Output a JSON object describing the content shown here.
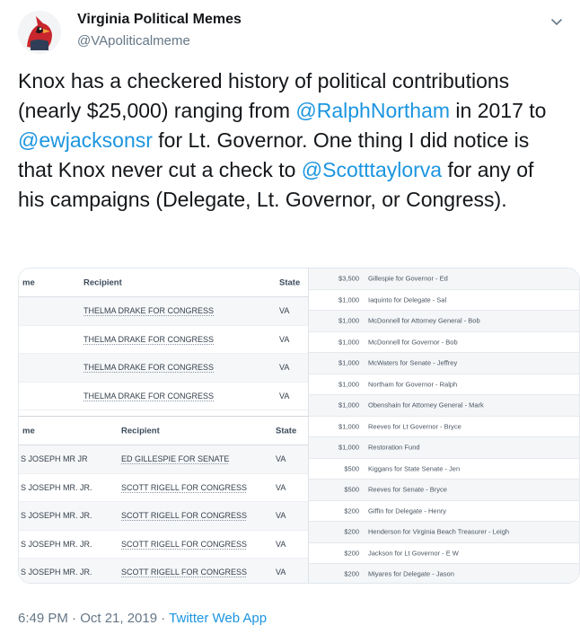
{
  "tweet": {
    "author_name": "Virginia Political Memes",
    "author_handle": "@VApoliticalmeme",
    "text_parts": {
      "p1": "Knox has a checkered history of political contributions (nearly $25,000) ranging from ",
      "m1": "@RalphNortham",
      "p2": " in 2017 to ",
      "m2": "@ewjacksonsr",
      "p3": " for Lt. Governor. One thing I did notice is that Knox never cut a check to ",
      "m3": "@Scotttaylorva",
      "p4": " for any of his campaigns (Delegate, Lt. Governor, or Congress)."
    },
    "timestamp": "6:49 PM · Oct 21, 2019 · ",
    "source_app": "Twitter Web App",
    "caret_icon": "chevron-down-icon",
    "avatar_icon": "cardinal-avatar-icon"
  },
  "colors": {
    "link": "#1b95e0",
    "secondary_text": "#657786"
  },
  "image": {
    "table1": {
      "headers": {
        "name": "me",
        "recipient": "Recipient",
        "state": "State"
      },
      "rows": [
        {
          "name": "",
          "recipient": "THELMA DRAKE FOR CONGRESS",
          "state": "VA"
        },
        {
          "name": "",
          "recipient": "THELMA DRAKE FOR CONGRESS",
          "state": "VA"
        },
        {
          "name": "",
          "recipient": "THELMA DRAKE FOR CONGRESS",
          "state": "VA"
        },
        {
          "name": "",
          "recipient": "THELMA DRAKE FOR CONGRESS",
          "state": "VA"
        }
      ]
    },
    "table2": {
      "headers": {
        "name": "me",
        "recipient": "Recipient",
        "state": "State"
      },
      "rows": [
        {
          "name": "S JOSEPH MR JR",
          "recipient": "ED GILLESPIE FOR SENATE",
          "state": "VA"
        },
        {
          "name": "S JOSEPH MR. JR.",
          "recipient": "SCOTT RIGELL FOR CONGRESS",
          "state": "VA"
        },
        {
          "name": "S JOSEPH MR. JR.",
          "recipient": "SCOTT RIGELL FOR CONGRESS",
          "state": "VA"
        },
        {
          "name": "S JOSEPH MR. JR.",
          "recipient": "SCOTT RIGELL FOR CONGRESS",
          "state": "VA"
        },
        {
          "name": "S JOSEPH MR. JR.",
          "recipient": "SCOTT RIGELL FOR CONGRESS",
          "state": "VA"
        }
      ]
    },
    "contributions": [
      {
        "amount": "$3,500",
        "desc": "Gillespie for Governor - Ed"
      },
      {
        "amount": "$1,000",
        "desc": "Iaquinto for Delegate - Sal"
      },
      {
        "amount": "$1,000",
        "desc": "McDonnell for Attorney General - Bob"
      },
      {
        "amount": "$1,000",
        "desc": "McDonnell for Governor - Bob"
      },
      {
        "amount": "$1,000",
        "desc": "McWaters for Senate - Jeffrey"
      },
      {
        "amount": "$1,000",
        "desc": "Northam for Governor - Ralph"
      },
      {
        "amount": "$1,000",
        "desc": "Obenshain for Attorney General - Mark"
      },
      {
        "amount": "$1,000",
        "desc": "Reeves for Lt Governor - Bryce"
      },
      {
        "amount": "$1,000",
        "desc": "Restoration Fund"
      },
      {
        "amount": "$500",
        "desc": "Kiggans for State Senate - Jen"
      },
      {
        "amount": "$500",
        "desc": "Reeves for Senate - Bryce"
      },
      {
        "amount": "$200",
        "desc": "Giffin for Delegate - Henry"
      },
      {
        "amount": "$200",
        "desc": "Henderson for Virginia Beach Treasurer - Leigh"
      },
      {
        "amount": "$200",
        "desc": "Jackson for Lt Governor - E W"
      },
      {
        "amount": "$200",
        "desc": "Miyares for Delegate - Jason"
      }
    ]
  }
}
